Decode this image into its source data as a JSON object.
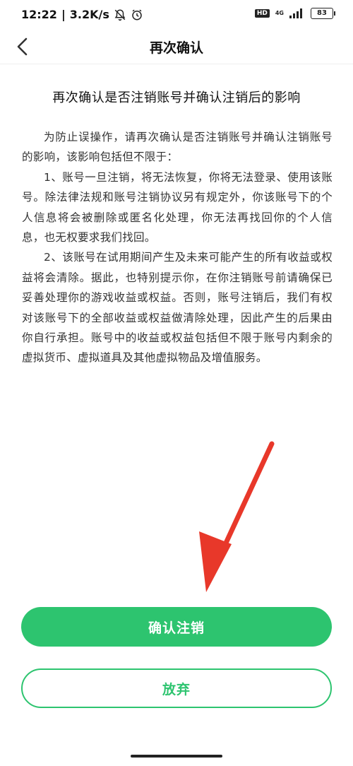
{
  "status_bar": {
    "time": "12:22",
    "speed": "3.2K/s",
    "hd": "HD",
    "network": "4G",
    "battery": "83"
  },
  "header": {
    "title": "再次确认"
  },
  "content": {
    "heading": "再次确认是否注销账号并确认注销后的影响",
    "paragraphs": [
      "为防止误操作，请再次确认是否注销账号并确认注销账号的影响，该影响包括但不限于：",
      "1、账号一旦注销，将无法恢复，你将无法登录、使用该账号。除法律法规和账号注销协议另有规定外，你该账号下的个人信息将会被删除或匿名化处理，你无法再找回你的个人信息，也无权要求我们找回。",
      "2、该账号在试用期间产生及未来可能产生的所有收益或权益将会清除。据此，也特别提示你，在你注销账号前请确保已妥善处理你的游戏收益或权益。否则，账号注销后，我们有权对该账号下的全部收益或权益做清除处理，因此产生的后果由你自行承担。账号中的收益或权益包括但不限于账号内剩余的虚拟货币、虚拟道具及其他虚拟物品及增值服务。"
    ]
  },
  "actions": {
    "confirm_label": "确认注销",
    "cancel_label": "放弃"
  },
  "colors": {
    "accent": "#2dc46f",
    "arrow": "#e8382a"
  },
  "icons": {
    "back": "chevron-left-icon",
    "silent": "bell-off-icon",
    "alarm": "alarm-icon"
  }
}
